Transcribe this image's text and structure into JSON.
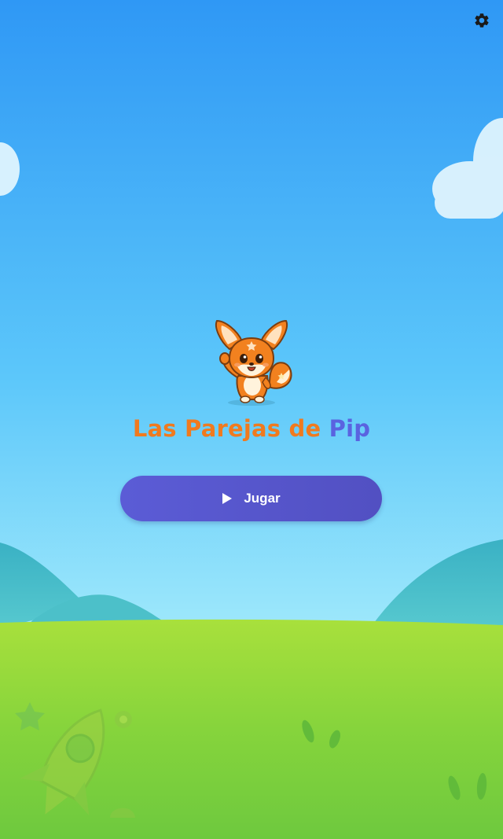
{
  "title": {
    "part1": "Las Parejas de ",
    "part2": "Pip"
  },
  "play_button": {
    "label": "Jugar",
    "icon": "play-icon"
  },
  "settings": {
    "icon": "gear-icon"
  },
  "colors": {
    "sky_top": "#2f9af5",
    "sky_bottom": "#a6ecfb",
    "grass": "#8fd63a",
    "title_orange": "#f07a1e",
    "title_blue": "#5a63e0",
    "button": "#5757cc"
  }
}
